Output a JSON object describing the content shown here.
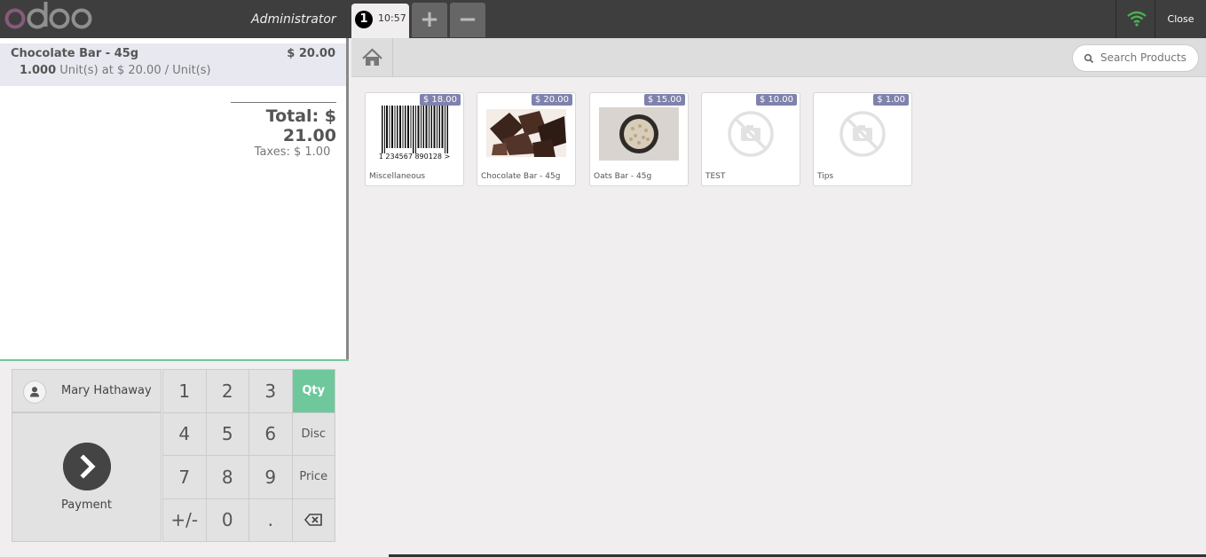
{
  "header": {
    "user_name": "Administrator",
    "order_number": "1",
    "order_time": "10:57",
    "add_label": "+",
    "remove_label": "−",
    "close_label": "Close"
  },
  "order": {
    "line": {
      "product": "Chocolate Bar - 45g",
      "price": "$ 20.00",
      "quantity": "1.000",
      "unit_info": "Unit(s) at $ 20.00 / Unit(s)"
    },
    "total": "Total: $ 21.00",
    "taxes": "Taxes: $ 1.00"
  },
  "controls": {
    "customer": "Mary Hathaway",
    "payment_label": "Payment",
    "keys": [
      "1",
      "2",
      "3",
      "Qty",
      "4",
      "5",
      "6",
      "Disc",
      "7",
      "8",
      "9",
      "Price",
      "+/-",
      "0",
      "."
    ],
    "active_mode": "Qty"
  },
  "search": {
    "placeholder": "Search Products"
  },
  "products": [
    {
      "name": "Miscellaneous",
      "price": "$ 18.00",
      "barcode_text": "1 234567 890128 >"
    },
    {
      "name": "Chocolate Bar - 45g",
      "price": "$ 20.00"
    },
    {
      "name": "Oats Bar - 45g",
      "price": "$ 15.00"
    },
    {
      "name": "TEST",
      "price": "$ 10.00"
    },
    {
      "name": "Tips",
      "price": "$ 1.00"
    }
  ],
  "colors": {
    "accent": "#6ec89b",
    "price_tag": "#7f82ac",
    "brand": "#875a7b",
    "wifi": "#4caf50"
  }
}
